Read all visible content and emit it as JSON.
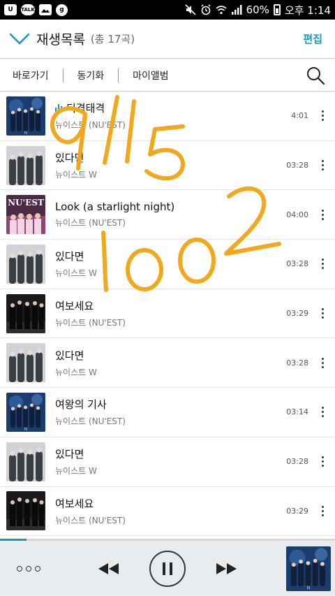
{
  "status_bar": {
    "battery": "60%",
    "time": "오후 1:14",
    "left_icons": [
      "U",
      "TALK",
      "gallery",
      "g"
    ],
    "right_icons": [
      "mute-icon",
      "alarm-icon",
      "wifi-icon",
      "signal-icon",
      "battery-icon"
    ]
  },
  "header": {
    "title": "재생목록",
    "count": "(총 17곡)",
    "edit_label": "편집"
  },
  "nav": {
    "items": [
      "바로가기",
      "동기화",
      "마이앨범"
    ]
  },
  "songs": [
    {
      "title": "티격태격",
      "artist": "뉴이스트 (NU'EST)",
      "duration": "4:01",
      "art": "night",
      "playing": true
    },
    {
      "title": "있다면",
      "artist": "뉴이스트 W",
      "duration": "03:28",
      "art": "grey"
    },
    {
      "title": "Look (a starlight night)",
      "artist": "뉴이스트 (NU'EST)",
      "duration": "04:00",
      "art": "look"
    },
    {
      "title": "있다면",
      "artist": "뉴이스트 W",
      "duration": "03:28",
      "art": "grey"
    },
    {
      "title": "여보세요",
      "artist": "뉴이스트 (NU'EST)",
      "duration": "03:29",
      "art": "dark"
    },
    {
      "title": "있다면",
      "artist": "뉴이스트 W",
      "duration": "03:28",
      "art": "grey"
    },
    {
      "title": "여왕의 기사",
      "artist": "뉴이스트 (NU'EST)",
      "duration": "03:14",
      "art": "night"
    },
    {
      "title": "있다면",
      "artist": "뉴이스트 W",
      "duration": "03:28",
      "art": "grey"
    },
    {
      "title": "여보세요",
      "artist": "뉴이스트 (NU'EST)",
      "duration": "03:29",
      "art": "dark"
    }
  ],
  "handwriting": {
    "line1": "9/15",
    "line2": "1002",
    "color": "#f2a81d"
  },
  "player": {
    "progress": 0.08,
    "accent": "#1a9bb5"
  }
}
